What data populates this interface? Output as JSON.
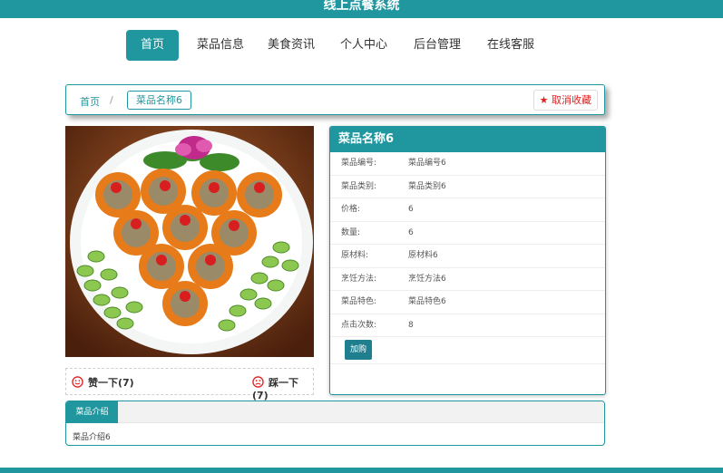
{
  "header": {
    "title": "线上点餐系统"
  },
  "nav": [
    {
      "label": "首页",
      "active": true
    },
    {
      "label": "菜品信息",
      "active": false
    },
    {
      "label": "美食资讯",
      "active": false
    },
    {
      "label": "个人中心",
      "active": false
    },
    {
      "label": "后台管理",
      "active": false
    },
    {
      "label": "在线客服",
      "active": false
    }
  ],
  "breadcrumb": {
    "home": "首页",
    "sep": "/",
    "current": "菜品名称6"
  },
  "favorite": {
    "label": "取消收藏",
    "icon": "star-icon"
  },
  "vote": {
    "like": "赞一下(7)",
    "dislike": "踩一下(7)"
  },
  "info": {
    "title": "菜品名称6",
    "rows": [
      {
        "k": "菜品编号:",
        "v": "菜品编号6"
      },
      {
        "k": "菜品类别:",
        "v": "菜品类别6"
      },
      {
        "k": "价格:",
        "v": "6"
      },
      {
        "k": "数量:",
        "v": "6"
      },
      {
        "k": "原材料:",
        "v": "原材料6"
      },
      {
        "k": "烹饪方法:",
        "v": "烹饪方法6"
      },
      {
        "k": "菜品特色:",
        "v": "菜品特色6"
      },
      {
        "k": "点击次数:",
        "v": "8"
      }
    ],
    "buy_label": "加购"
  },
  "tabs": {
    "active_label": "菜品介绍",
    "content": "菜品介绍6"
  },
  "colors": {
    "accent": "#20969e",
    "danger": "#e02020"
  }
}
